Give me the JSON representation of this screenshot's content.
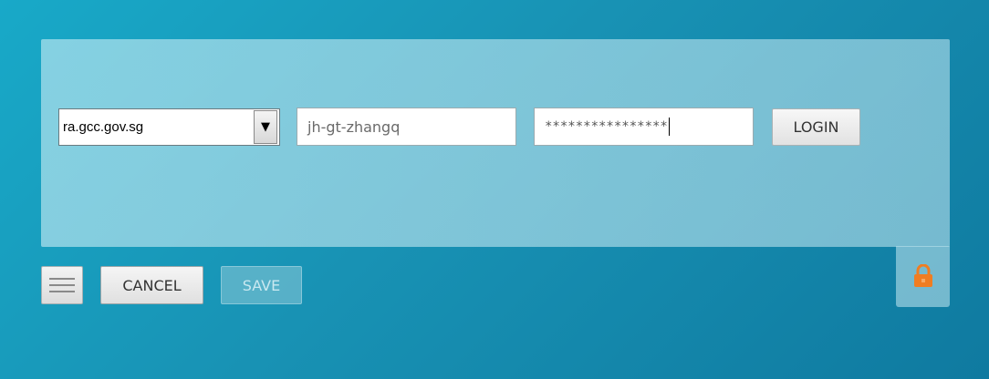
{
  "login": {
    "domain_selected": "ra.gcc.gov.sg",
    "username_value": "jh-gt-zhangq",
    "password_value": "****************",
    "login_label": "LOGIN"
  },
  "footer": {
    "cancel_label": "CANCEL",
    "save_label": "SAVE"
  },
  "icons": {
    "menu": "hamburger-menu-icon",
    "lock": "padlock-icon",
    "dropdown": "triangle-down-icon"
  },
  "colors": {
    "lock": "#f07d22",
    "background": "#1892b4"
  }
}
